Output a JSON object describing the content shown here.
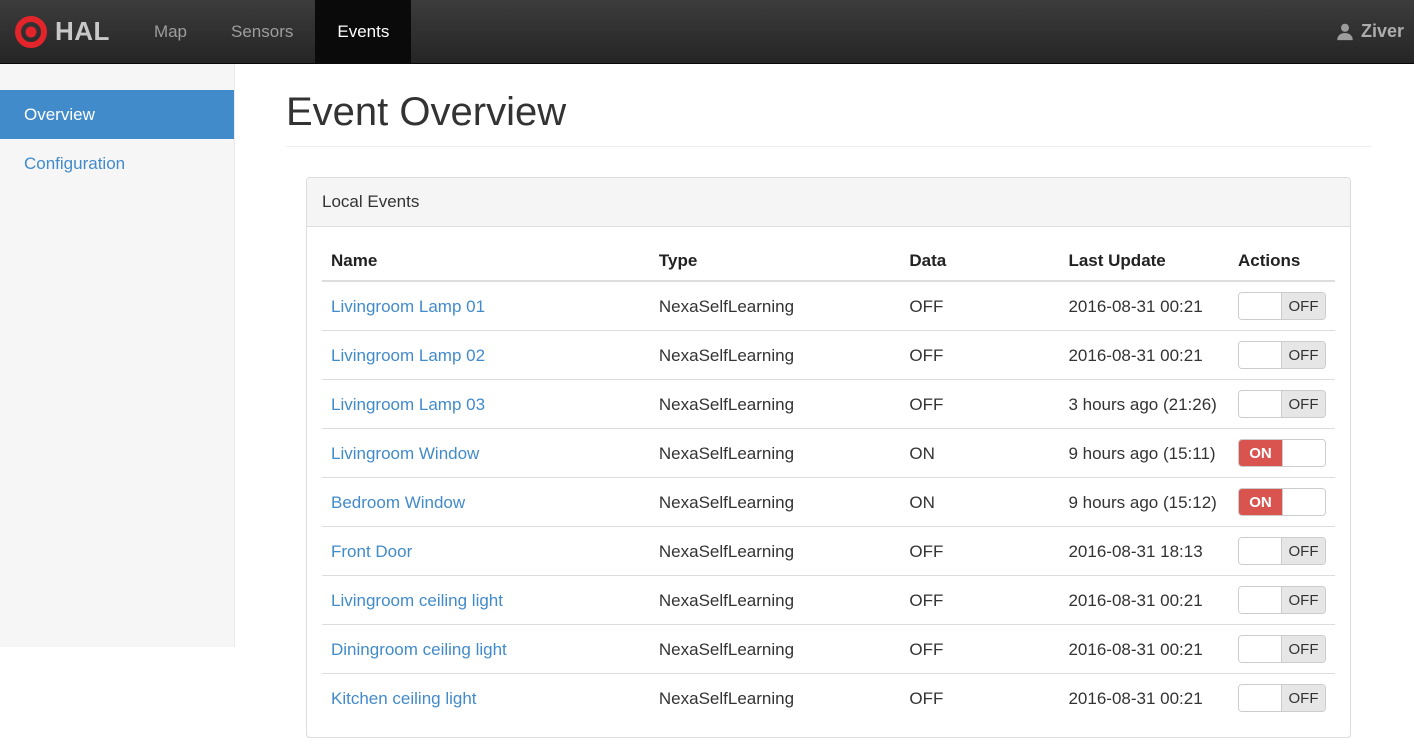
{
  "navbar": {
    "brand": "HAL",
    "items": [
      {
        "label": "Map",
        "active": false
      },
      {
        "label": "Sensors",
        "active": false
      },
      {
        "label": "Events",
        "active": true
      }
    ],
    "user": "Ziver"
  },
  "sidebar": {
    "items": [
      {
        "label": "Overview",
        "active": true
      },
      {
        "label": "Configuration",
        "active": false
      }
    ]
  },
  "main": {
    "title": "Event Overview",
    "panel": {
      "title": "Local Events",
      "table": {
        "columns": [
          "Name",
          "Type",
          "Data",
          "Last Update",
          "Actions"
        ],
        "rows": [
          {
            "name": "Livingroom Lamp 01",
            "type": "NexaSelfLearning",
            "data": "OFF",
            "last_update": "2016-08-31 00:21",
            "toggle": "OFF"
          },
          {
            "name": "Livingroom Lamp 02",
            "type": "NexaSelfLearning",
            "data": "OFF",
            "last_update": "2016-08-31 00:21",
            "toggle": "OFF"
          },
          {
            "name": "Livingroom Lamp 03",
            "type": "NexaSelfLearning",
            "data": "OFF",
            "last_update": "3 hours ago (21:26)",
            "toggle": "OFF"
          },
          {
            "name": "Livingroom Window",
            "type": "NexaSelfLearning",
            "data": "ON",
            "last_update": "9 hours ago (15:11)",
            "toggle": "ON"
          },
          {
            "name": "Bedroom Window",
            "type": "NexaSelfLearning",
            "data": "ON",
            "last_update": "9 hours ago (15:12)",
            "toggle": "ON"
          },
          {
            "name": "Front Door",
            "type": "NexaSelfLearning",
            "data": "OFF",
            "last_update": "2016-08-31 18:13",
            "toggle": "OFF"
          },
          {
            "name": "Livingroom ceiling light",
            "type": "NexaSelfLearning",
            "data": "OFF",
            "last_update": "2016-08-31 00:21",
            "toggle": "OFF"
          },
          {
            "name": "Diningroom ceiling light",
            "type": "NexaSelfLearning",
            "data": "OFF",
            "last_update": "2016-08-31 00:21",
            "toggle": "OFF"
          },
          {
            "name": "Kitchen ceiling light",
            "type": "NexaSelfLearning",
            "data": "OFF",
            "last_update": "2016-08-31 00:21",
            "toggle": "OFF"
          }
        ]
      }
    }
  },
  "icons": {
    "logo": "bullseye-icon",
    "user": "person-icon"
  },
  "colors": {
    "accent_blue": "#428bca",
    "toggle_on_red": "#d9534f",
    "navbar_dark": "#2b2b2b",
    "navbar_active": "#0a0a0a",
    "sidebar_bg": "#f6f6f6",
    "panel_header_bg": "#f5f5f5",
    "logo_red": "#e3242b"
  }
}
